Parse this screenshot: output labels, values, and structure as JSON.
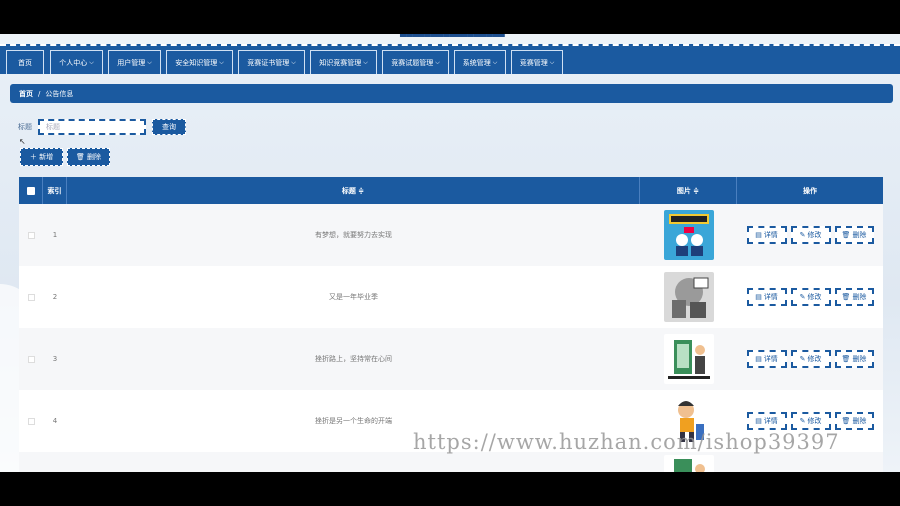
{
  "header": {
    "app_title": "█████████████████"
  },
  "nav": {
    "items": [
      {
        "label": "首页",
        "has_caret": false
      },
      {
        "label": "个人中心",
        "has_caret": true
      },
      {
        "label": "用户管理",
        "has_caret": true
      },
      {
        "label": "安全知识管理",
        "has_caret": true
      },
      {
        "label": "竞赛证书管理",
        "has_caret": true
      },
      {
        "label": "知识竞赛管理",
        "has_caret": true
      },
      {
        "label": "竞赛试题管理",
        "has_caret": true
      },
      {
        "label": "系统管理",
        "has_caret": true
      },
      {
        "label": "竞赛管理",
        "has_caret": true
      }
    ],
    "caret_glyph": "⌵"
  },
  "breadcrumb": {
    "home": "首页",
    "separator": "/",
    "current": "公告信息"
  },
  "search": {
    "label": "标题",
    "placeholder": "标题",
    "button": "查询"
  },
  "actions": {
    "add": "＋ 新增",
    "delete": "🗑 删除"
  },
  "table": {
    "columns": {
      "index": "索引",
      "title": "标题 ≑",
      "image": "图片 ≑",
      "ops": "操作"
    },
    "rows": [
      {
        "index": "1",
        "title": "有梦想，就要努力去实现"
      },
      {
        "index": "2",
        "title": "又是一年毕业季"
      },
      {
        "index": "3",
        "title": "挫折路上，坚持常在心间"
      },
      {
        "index": "4",
        "title": "挫折是另一个生命的开端"
      }
    ],
    "op_labels": {
      "detail": "详情",
      "edit": "修改",
      "delete": "删除"
    }
  },
  "watermark": "https://www.huzhan.com/ishop39397",
  "colors": {
    "primary": "#1b5aa0",
    "background": "#e4ecf5"
  }
}
